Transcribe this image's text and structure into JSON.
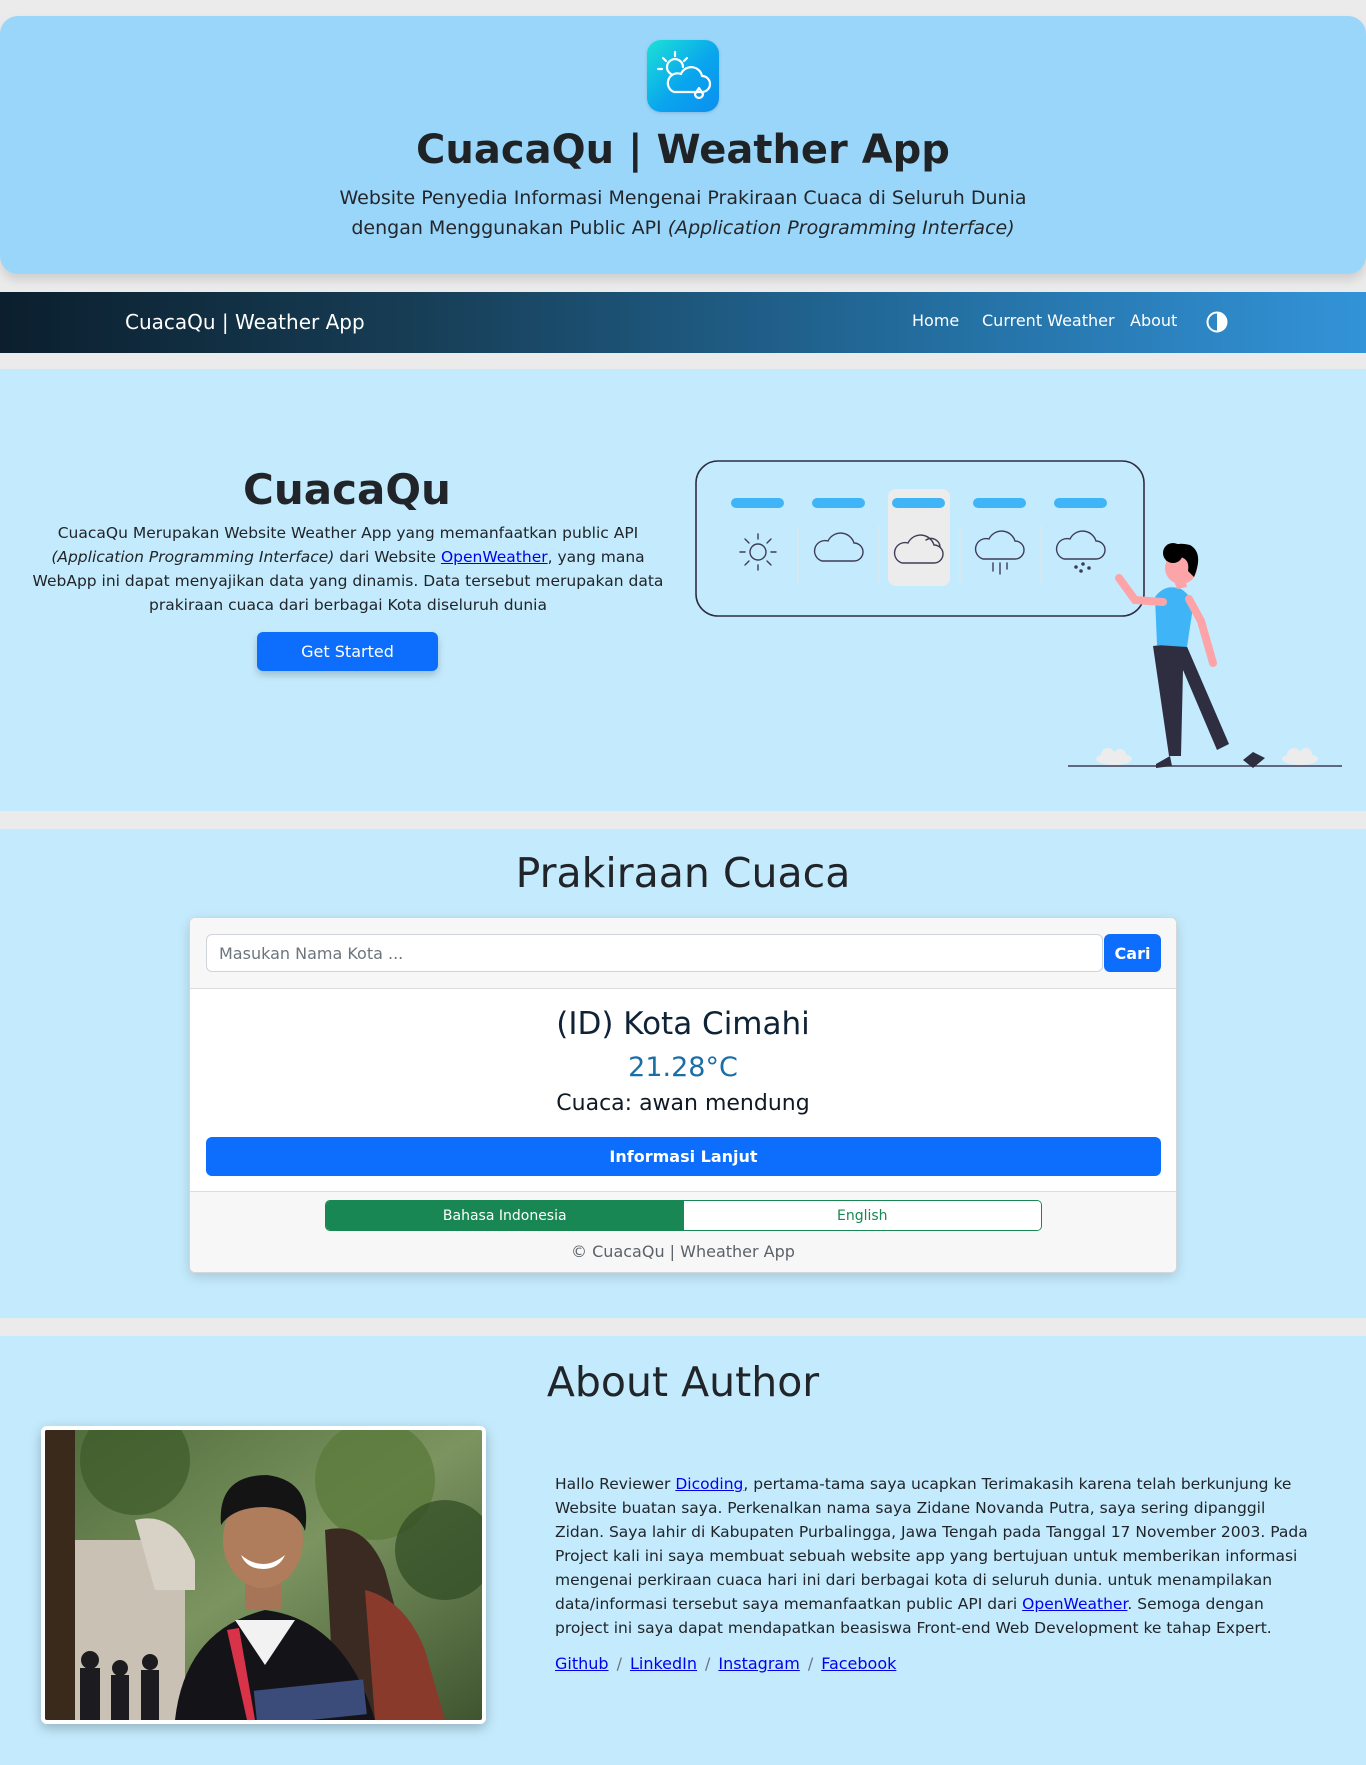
{
  "header": {
    "title": "CuacaQu | Weather App",
    "subtitle_line1": "Website Penyedia Informasi Mengenai Prakiraan Cuaca di Seluruh Dunia",
    "subtitle_line2": "dengan Menggunakan Public API",
    "subtitle_italic": "(Application Programming Interface)",
    "logo_icon": "cloud-sun-rain-icon"
  },
  "navbar": {
    "brand": "CuacaQu | Weather App",
    "links": [
      "Home",
      "Current Weather",
      "About"
    ],
    "theme_icon": "contrast-toggle-icon"
  },
  "intro": {
    "title": "CuacaQu",
    "text_1": "CuacaQu Merupakan Website Weather App yang memanfaatkan public API",
    "text_italic": "(Application Programming Interface)",
    "text_2": "dari Website",
    "link": "OpenWeather",
    "text_3": ", yang mana WebApp ini dapat menyajikan data yang dinamis. Data tersebut merupakan data prakiraan cuaca dari berbagai Kota diseluruh dunia",
    "button": "Get Started"
  },
  "forecast": {
    "title": "Prakiraan Cuaca",
    "search_placeholder": "Masukan Nama Kota ...",
    "search_value": "",
    "search_button": "Cari",
    "city": "(ID) Kota Cimahi",
    "temperature": "21.28°C",
    "condition": "Cuaca: awan mendung",
    "info_button": "Informasi Lanjut",
    "languages": [
      "Bahasa Indonesia",
      "English"
    ],
    "selected_language": "Bahasa Indonesia",
    "copyright": "© CuacaQu | Wheather App"
  },
  "about": {
    "title": "About Author",
    "text_1": "Hallo Reviewer",
    "link_dicoding": "Dicoding",
    "text_2": ", pertama-tama saya ucapkan Terimakasih karena telah berkunjung ke Website buatan saya. Perkenalkan nama saya Zidane Novanda Putra, saya sering dipanggil Zidan. Saya lahir di Kabupaten Purbalingga, Jawa Tengah pada Tanggal 17 November 2003. Pada Project kali ini saya membuat sebuah website app yang bertujuan untuk memberikan informasi mengenai perkiraan cuaca hari ini dari berbagai kota di seluruh dunia. untuk menampilakan data/informasi tersebut saya memanfaatkan public API dari",
    "link_openweather": "OpenWeather",
    "text_3": ". Semoga dengan project ini saya dapat mendapatkan beasiswa Front-end Web Development ke tahap Expert.",
    "social": [
      "Github",
      "LinkedIn",
      "Instagram",
      "Facebook"
    ],
    "separator": "/"
  },
  "colors": {
    "header_bg": "#9ad6fa",
    "section_bg": "#c4ebfd",
    "primary": "#0d6efd",
    "success": "#198754",
    "temperature": "#1a6ea6"
  }
}
